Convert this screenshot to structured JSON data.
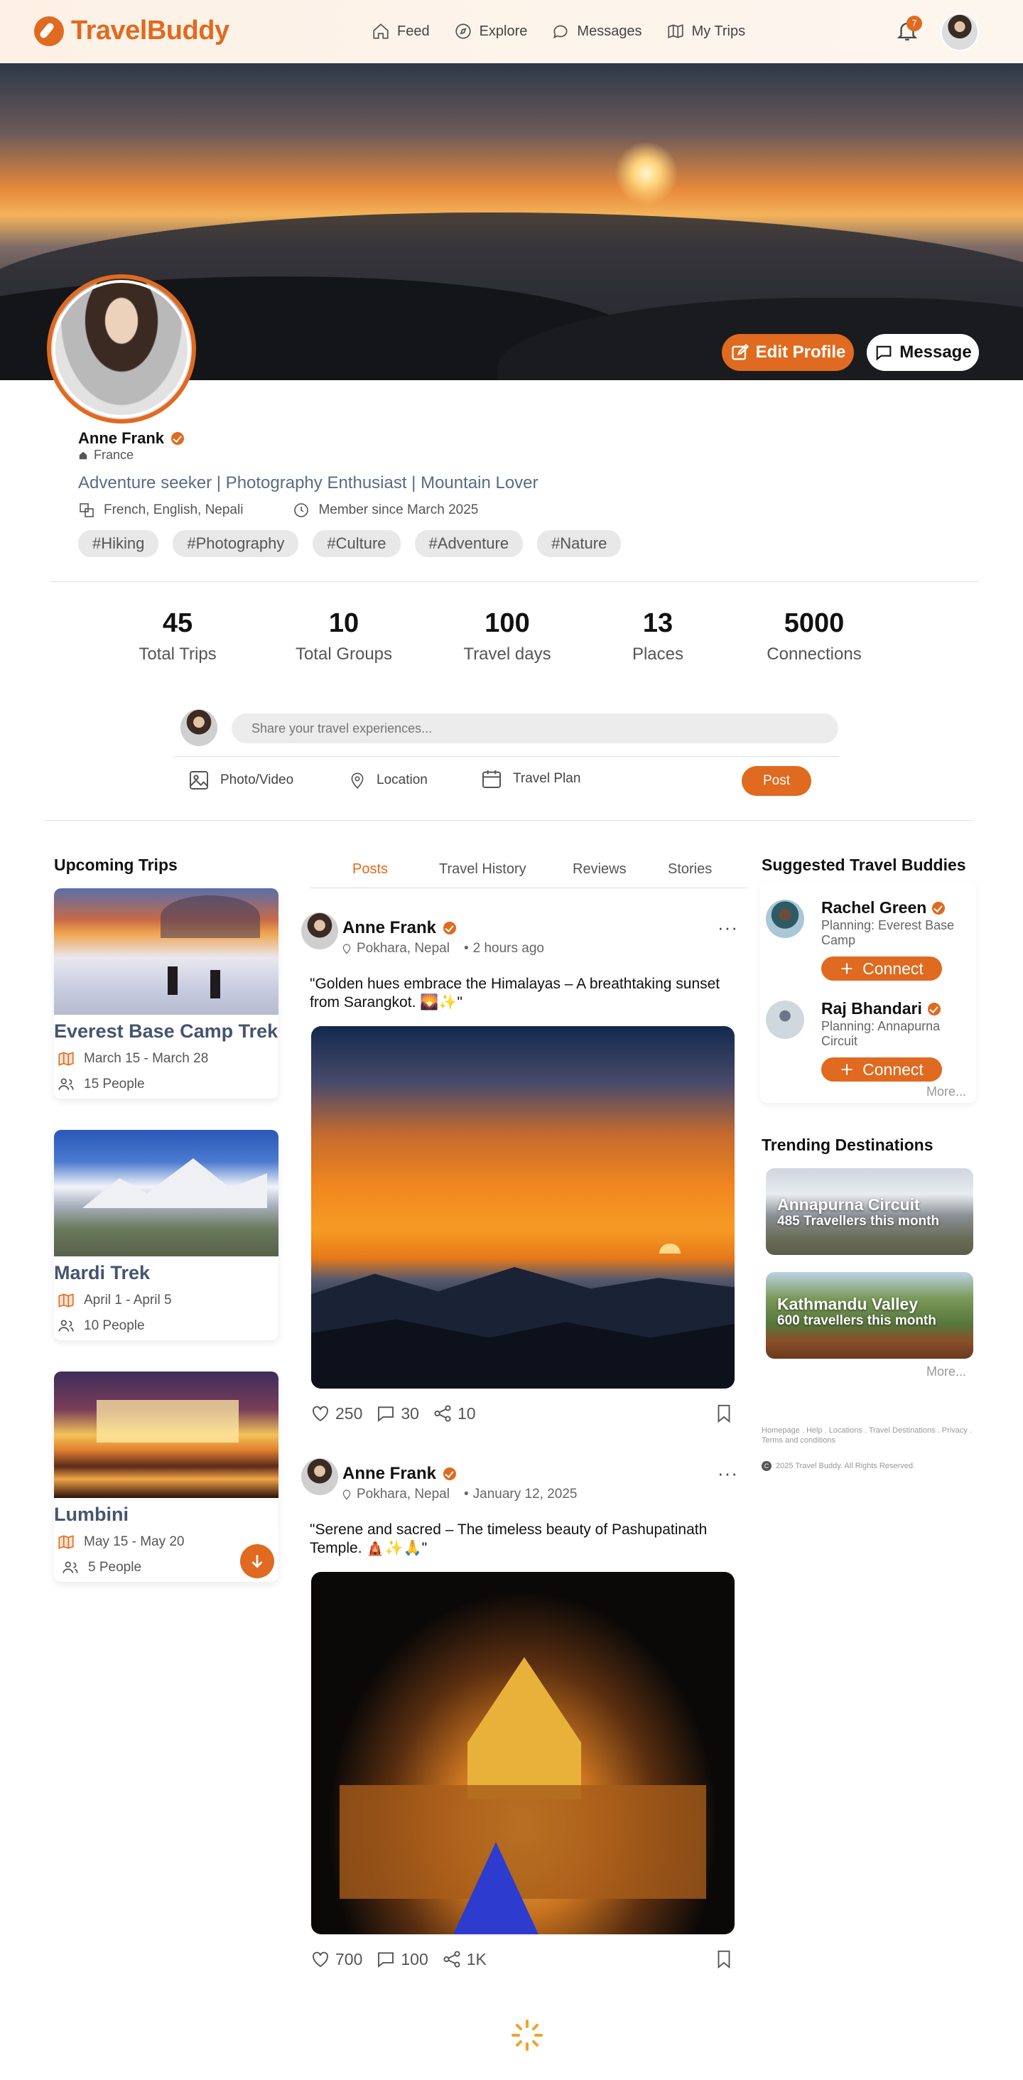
{
  "brand": {
    "name": "TravelBuddy",
    "accent": "#e06a1f"
  },
  "nav": {
    "items": [
      {
        "label": "Feed",
        "icon": "home-icon"
      },
      {
        "label": "Explore",
        "icon": "compass-icon"
      },
      {
        "label": "Messages",
        "icon": "chat-icon"
      },
      {
        "label": "My Trips",
        "icon": "map-icon"
      }
    ],
    "notification_count": "7"
  },
  "profile": {
    "edit_label": "Edit Profile",
    "message_label": "Message",
    "name": "Anne Frank",
    "country": "France",
    "bio": "Adventure seeker | Photography Enthusiast | Mountain Lover",
    "languages": "French, English, Nepali",
    "member_since": "Member since March 2025",
    "tags": [
      "#Hiking",
      "#Photography",
      "#Culture",
      "#Adventure",
      "#Nature"
    ]
  },
  "stats": [
    {
      "value": "45",
      "label": "Total Trips"
    },
    {
      "value": "10",
      "label": "Total Groups"
    },
    {
      "value": "100",
      "label": "Travel days"
    },
    {
      "value": "13",
      "label": "Places"
    },
    {
      "value": "5000",
      "label": "Connections"
    }
  ],
  "composer": {
    "placeholder": "Share your travel experiences...",
    "photo_label": "Photo/Video",
    "location_label": "Location",
    "plan_label": "Travel Plan",
    "post_label": "Post"
  },
  "upcoming": {
    "title": "Upcoming Trips",
    "trips": [
      {
        "name": "Everest Base Camp Trek",
        "dates": "March 15 - March 28",
        "people": "15 People"
      },
      {
        "name": "Mardi Trek",
        "dates": "April 1 - April 5",
        "people": "10 People"
      },
      {
        "name": "Lumbini",
        "dates": "May 15 - May 20",
        "people": "5 People"
      }
    ]
  },
  "feed": {
    "tabs": [
      "Posts",
      "Travel History",
      "Reviews",
      "Stories"
    ],
    "active_tab": "Posts",
    "posts": [
      {
        "author": "Anne Frank",
        "location": "Pokhara, Nepal",
        "time": "2 hours ago",
        "text": "\"Golden hues embrace the Himalayas – A breathtaking sunset from Sarangkot. 🌄✨\"",
        "likes": "250",
        "comments": "30",
        "shares": "10"
      },
      {
        "author": "Anne Frank",
        "location": "Pokhara, Nepal",
        "time": "January 12, 2025",
        "text": "\"Serene and sacred – The timeless beauty of Pashupatinath Temple. 🛕✨🙏\"",
        "likes": "700",
        "comments": "100",
        "shares": "1K"
      }
    ]
  },
  "buddies": {
    "title": "Suggested Travel Buddies",
    "items": [
      {
        "name": "Rachel Green",
        "plan": "Planning: Everest Base Camp",
        "connect": "Connect"
      },
      {
        "name": "Raj Bhandari",
        "plan": "Planning: Annapurna Circuit",
        "connect": "Connect"
      }
    ],
    "more": "More..."
  },
  "trending": {
    "title": "Trending Destinations",
    "items": [
      {
        "name": "Annapurna Circuit",
        "stat": "485 Travellers this month"
      },
      {
        "name": "Kathmandu Valley",
        "stat": "600 travellers this month"
      }
    ],
    "more": "More..."
  },
  "footer": {
    "links": "Homepage . Help . Locations . Travel Destinations . Privacy . Terms and conditions",
    "copyright": "2025 Travel Buddy. All Rights Reserved."
  }
}
